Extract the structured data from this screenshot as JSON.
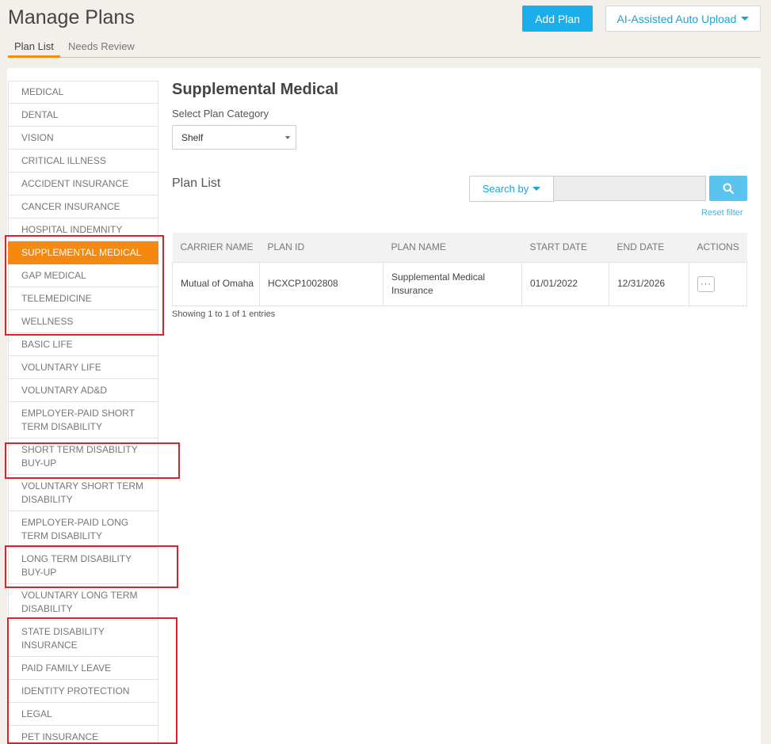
{
  "header": {
    "title": "Manage Plans",
    "add_plan_label": "Add Plan",
    "ai_upload_label": "AI-Assisted Auto Upload"
  },
  "tabs": [
    {
      "label": "Plan List",
      "active": true
    },
    {
      "label": "Needs Review",
      "active": false
    }
  ],
  "sidebar": {
    "items": [
      {
        "label": "MEDICAL"
      },
      {
        "label": "DENTAL"
      },
      {
        "label": "VISION"
      },
      {
        "label": "CRITICAL ILLNESS"
      },
      {
        "label": "ACCIDENT INSURANCE"
      },
      {
        "label": "CANCER INSURANCE"
      },
      {
        "label": "HOSPITAL INDEMNITY"
      },
      {
        "label": "SUPPLEMENTAL MEDICAL",
        "active": true
      },
      {
        "label": "GAP MEDICAL"
      },
      {
        "label": "TELEMEDICINE"
      },
      {
        "label": "WELLNESS"
      },
      {
        "label": "BASIC LIFE"
      },
      {
        "label": "VOLUNTARY LIFE"
      },
      {
        "label": "VOLUNTARY AD&D"
      },
      {
        "label": "EMPLOYER-PAID SHORT TERM DISABILITY"
      },
      {
        "label": "SHORT TERM DISABILITY BUY-UP"
      },
      {
        "label": "VOLUNTARY SHORT TERM DISABILITY"
      },
      {
        "label": "EMPLOYER-PAID LONG TERM DISABILITY"
      },
      {
        "label": "LONG TERM DISABILITY BUY-UP"
      },
      {
        "label": "VOLUNTARY LONG TERM DISABILITY"
      },
      {
        "label": "STATE DISABILITY INSURANCE"
      },
      {
        "label": "PAID FAMILY LEAVE"
      },
      {
        "label": "IDENTITY PROTECTION"
      },
      {
        "label": "LEGAL"
      },
      {
        "label": "PET INSURANCE"
      }
    ]
  },
  "main": {
    "section_title": "Supplemental Medical",
    "category_label": "Select Plan Category",
    "category_value": "Shelf",
    "plan_list_title": "Plan List",
    "search_by_label": "Search by",
    "search_value": "",
    "reset_filter_label": "Reset filter",
    "table": {
      "columns": [
        "CARRIER NAME",
        "PLAN ID",
        "PLAN NAME",
        "START DATE",
        "END DATE",
        "ACTIONS"
      ],
      "rows": [
        {
          "carrier": "Mutual of Omaha",
          "plan_id": "HCXCP1002808",
          "plan_name": "Supplemental Medical Insurance",
          "start": "01/01/2022",
          "end": "12/31/2026",
          "actions": "···"
        }
      ]
    },
    "showing_text": "Showing 1 to 1 of 1 entries"
  },
  "colors": {
    "accent_orange": "#f5890f",
    "primary_blue": "#1aaeea",
    "highlight_red": "#d9232d"
  }
}
